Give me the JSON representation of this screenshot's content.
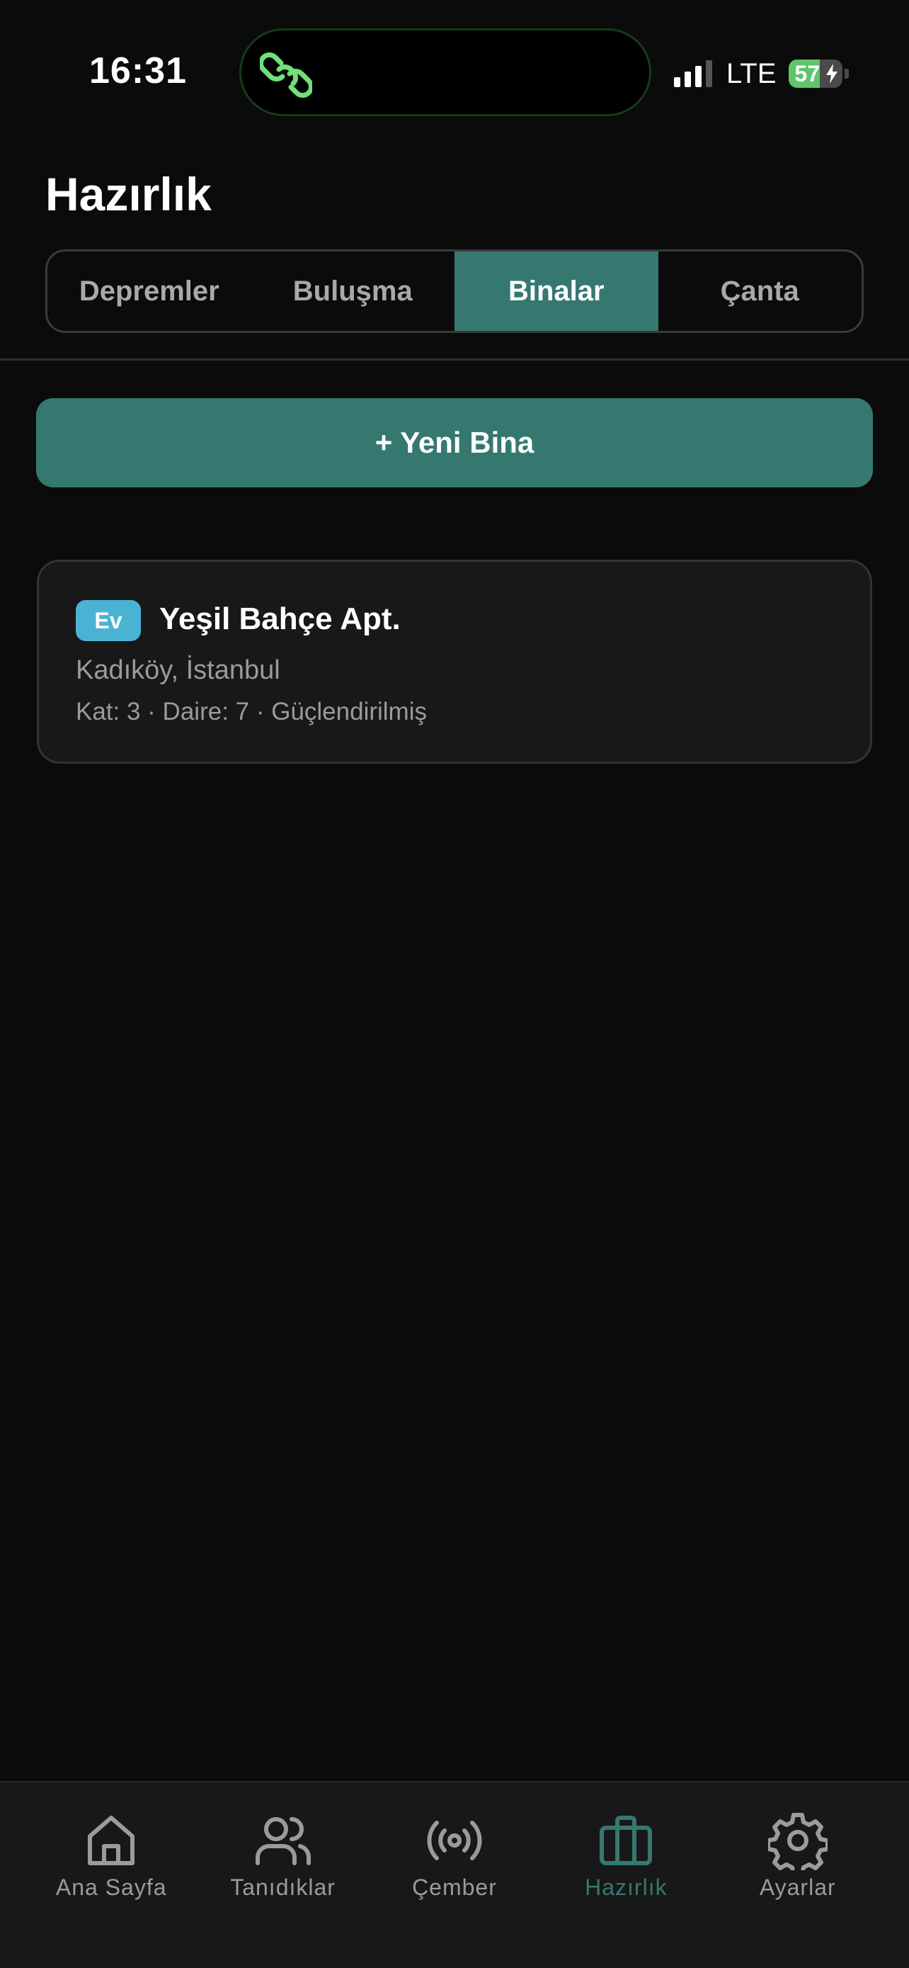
{
  "status_bar": {
    "time": "16:31",
    "network": "LTE",
    "battery": "57",
    "battery_level": 0.57,
    "signal_bars": 3
  },
  "header": {
    "title": "Hazırlık"
  },
  "segments": [
    {
      "label": "Depremler",
      "active": false
    },
    {
      "label": "Buluşma",
      "active": false
    },
    {
      "label": "Binalar",
      "active": true
    },
    {
      "label": "Çanta",
      "active": false
    }
  ],
  "actions": {
    "new_building_label": "+ Yeni Bina"
  },
  "buildings": [
    {
      "badge": "Ev",
      "name": "Yeşil Bahçe Apt.",
      "location": "Kadıköy, İstanbul",
      "meta": "Kat: 3 · Daire: 7 · Güçlendirilmiş"
    }
  ],
  "tabbar": [
    {
      "label": "Ana Sayfa",
      "icon": "home-icon",
      "active": false
    },
    {
      "label": "Tanıdıklar",
      "icon": "people-icon",
      "active": false
    },
    {
      "label": "Çember",
      "icon": "broadcast-icon",
      "active": false
    },
    {
      "label": "Hazırlık",
      "icon": "briefcase-icon",
      "active": true
    },
    {
      "label": "Ayarlar",
      "icon": "gear-icon",
      "active": false
    }
  ],
  "colors": {
    "accent": "#357870",
    "background": "#0b0b0b",
    "card": "#181818",
    "badge": "#4ab3d3",
    "battery": "#5ec56a",
    "island_icon": "#6fe07a"
  }
}
